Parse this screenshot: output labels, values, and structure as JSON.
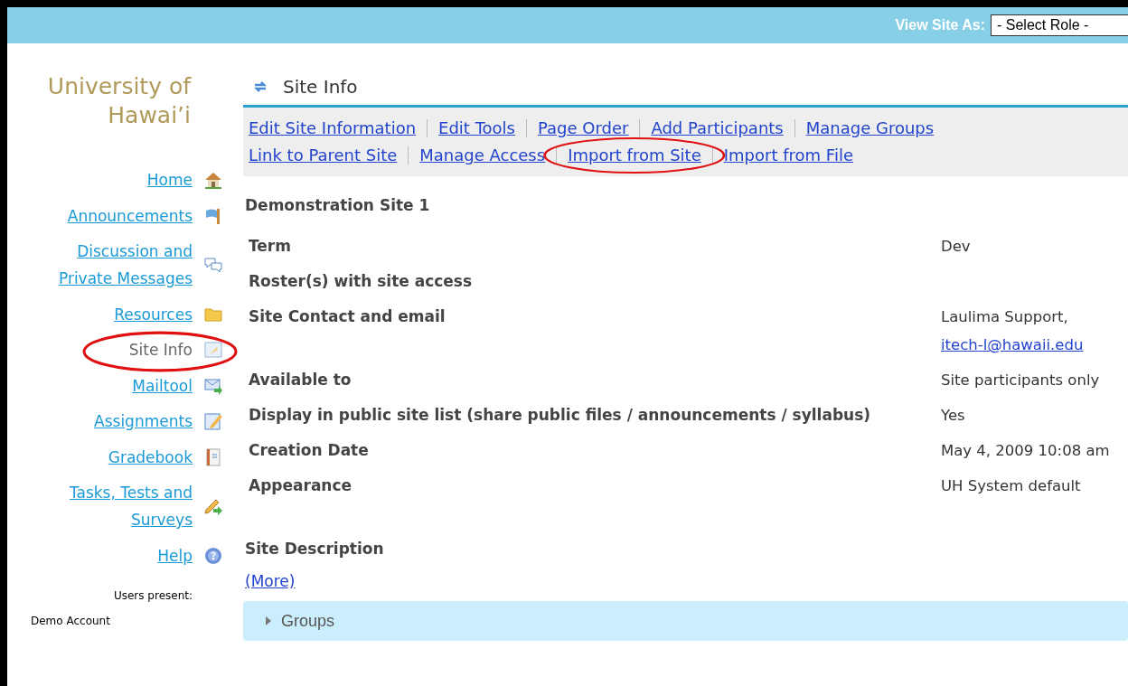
{
  "top_bar": {
    "label": "View Site As:",
    "role_select": {
      "value": "- Select Role -"
    }
  },
  "sidebar": {
    "logo": [
      "University of",
      "Hawai’i"
    ],
    "items": [
      {
        "label": "Home",
        "kind": "home",
        "selected": false,
        "circled": false
      },
      {
        "label": "Announcements",
        "kind": "flag",
        "selected": false,
        "circled": false
      },
      {
        "label": "Discussion and Private Messages",
        "kind": "chat",
        "selected": false,
        "circled": false
      },
      {
        "label": "Resources",
        "kind": "folder",
        "selected": false,
        "circled": false
      },
      {
        "label": "Site Info",
        "kind": "info",
        "selected": true,
        "circled": true
      },
      {
        "label": "Mailtool",
        "kind": "mail",
        "selected": false,
        "circled": false
      },
      {
        "label": "Assignments",
        "kind": "pencil",
        "selected": false,
        "circled": false
      },
      {
        "label": "Gradebook",
        "kind": "book",
        "selected": false,
        "circled": false
      },
      {
        "label": "Tasks, Tests and Surveys",
        "kind": "tasks",
        "selected": false,
        "circled": false
      },
      {
        "label": "Help",
        "kind": "help",
        "selected": false,
        "circled": false
      }
    ],
    "users_present_label": "Users present:",
    "users": [
      "Demo Account"
    ]
  },
  "tool": {
    "title": "Site Info",
    "actions": [
      [
        {
          "label": "Edit Site Information",
          "circled": false
        },
        {
          "label": "Edit Tools",
          "circled": false
        },
        {
          "label": "Page Order",
          "circled": false
        },
        {
          "label": "Add Participants",
          "circled": false
        },
        {
          "label": "Manage Groups",
          "circled": false
        }
      ],
      [
        {
          "label": "Link to Parent Site",
          "circled": false
        },
        {
          "label": "Manage Access",
          "circled": false
        },
        {
          "label": "Import from Site",
          "circled": true
        },
        {
          "label": "Import from File",
          "circled": false
        }
      ]
    ],
    "site_name": "Demonstration Site 1",
    "details": [
      {
        "label": "Term",
        "value": "Dev"
      },
      {
        "label": "Roster(s) with site access"
      },
      {
        "label": "Site Contact and email",
        "value": "Laulima Support,",
        "link": "itech-l@hawaii.edu"
      },
      {
        "label": "Available to",
        "value": "Site participants only"
      },
      {
        "label": "Display in public site list (share public files / announcements / syllabus)",
        "value": "Yes"
      },
      {
        "label": "Creation Date",
        "value": "May 4, 2009 10:08 am"
      },
      {
        "label": "Appearance",
        "value": "UH System default"
      }
    ],
    "description_heading": "Site Description",
    "more_link": "(More)",
    "groups_panel": {
      "label": "Groups",
      "expanded": false
    }
  }
}
